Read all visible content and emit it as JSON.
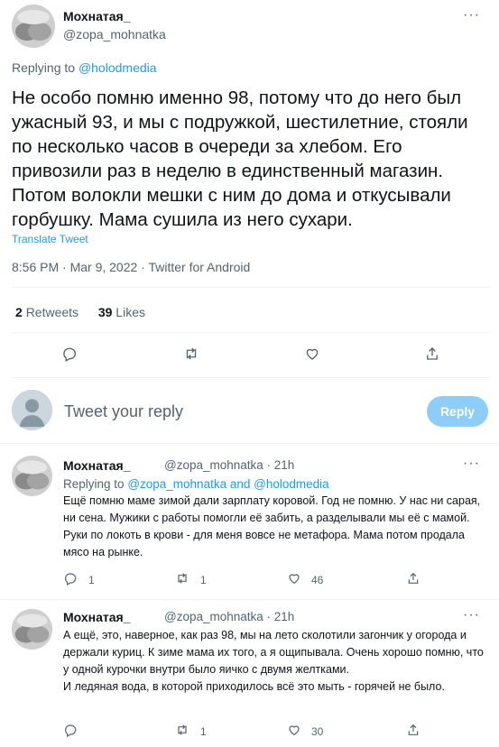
{
  "main_tweet": {
    "author_name": "Мохнатая_",
    "author_handle": "@zopa_mohnatka",
    "replying_prefix": "Replying to",
    "replying_to": "@holodmedia",
    "text": "Не особо помню именно 98, потому что до него был ужасный 93, и мы с подружкой, шестилетние, стояли по несколько часов в очереди за хлебом. Его привозили раз в неделю в единственный магазин. Потом волокли мешки с ним до дома и откусывали горбушку. Мама сушила из него сухари.",
    "translate_label": "Translate Tweet",
    "meta": "8:56 PM · Mar 9, 2022 · Twitter for Android",
    "retweets_count": "2",
    "retweets_label": "Retweets",
    "likes_count": "39",
    "likes_label": "Likes"
  },
  "composer": {
    "placeholder": "Tweet your reply",
    "reply_button": "Reply"
  },
  "replies": [
    {
      "author_name": "Мохнатая_",
      "handle_time": "@zopa_mohnatka · 21h",
      "replying_prefix": "Replying to",
      "replying_to": "@zopa_mohnatka and @holodmedia",
      "text": "Ещё помню маме зимой дали зарплату коровой. Год не помню. У нас ни сарая, ни сена. Мужики с работы помогли её забить, а разделывали мы её с мамой. Руки по локоть в крови - для меня вовсе не метафора. Мама потом продала мясо на рынке.",
      "reply_count": "1",
      "retweet_count": "1",
      "like_count": "46"
    },
    {
      "author_name": "Мохнатая_",
      "handle_time": "@zopa_mohnatka · 21h",
      "text": "А ещё, это, наверное, как раз 98, мы на лето сколотили загончик у огорода и держали куриц. К зиме мама их того, а я ощипывала. Очень хорошо помню, что у одной курочки внутри было яичко с двумя желтками.\nИ ледяная вода, в которой приходилось всё это мыть - горячей не было.",
      "reply_count": "",
      "retweet_count": "1",
      "like_count": "30"
    }
  ],
  "icons": [
    "more-icon",
    "reply-icon",
    "retweet-icon",
    "like-icon",
    "share-icon"
  ],
  "colors": {
    "accent": "#1d9bf0",
    "reply_button": "#8ecdf8",
    "muted": "#536471"
  }
}
